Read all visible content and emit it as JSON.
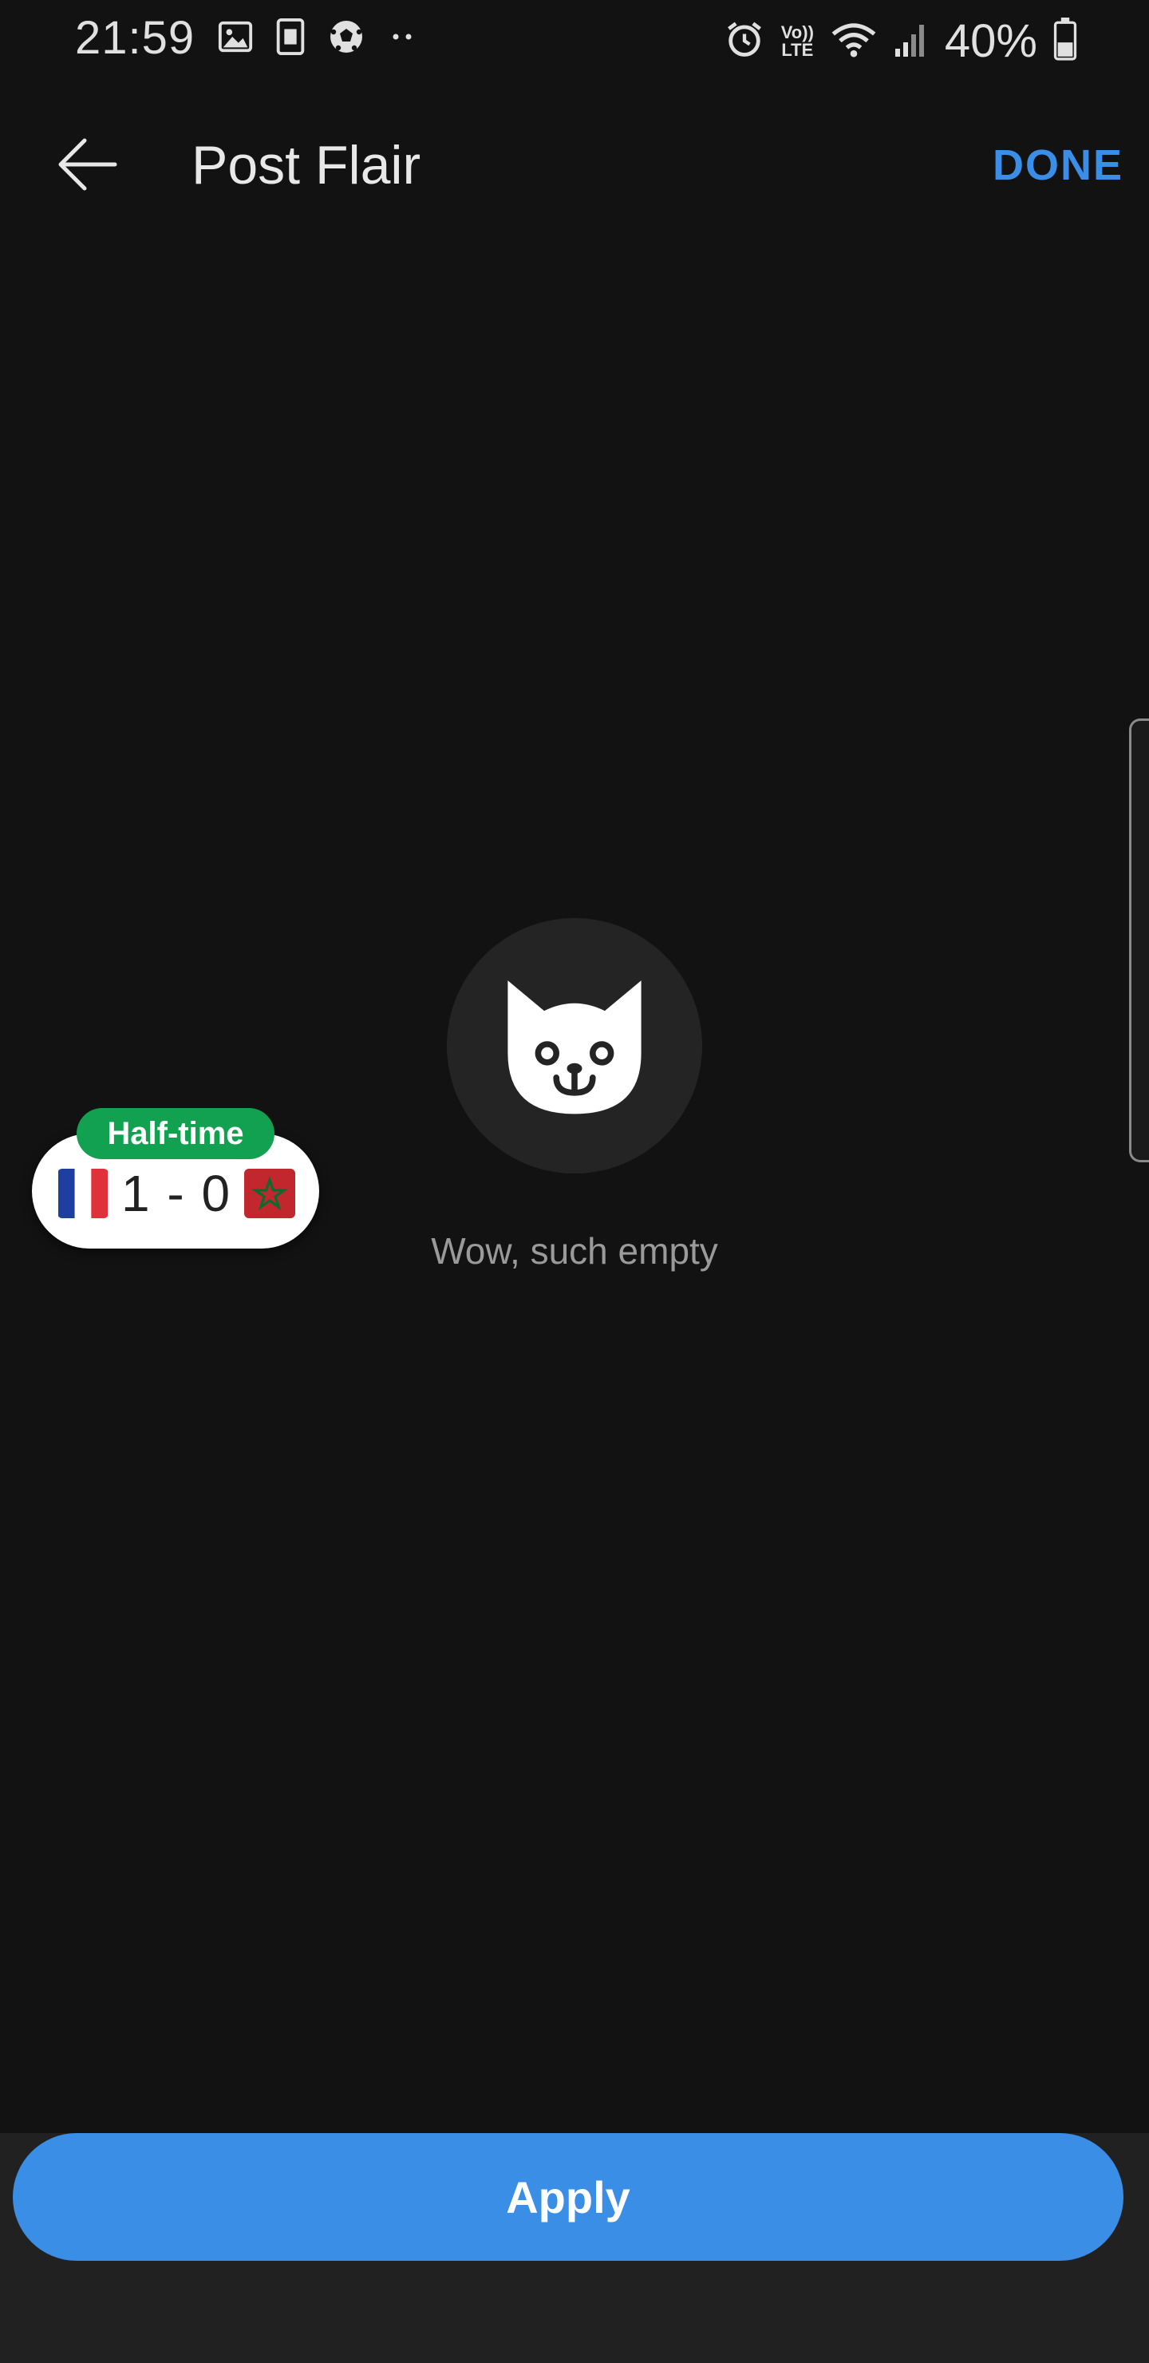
{
  "status_bar": {
    "time": "21:59",
    "battery": "40%",
    "left_icons": [
      "image-icon",
      "sim-card-icon",
      "soccer-ball-icon",
      "dots-icon"
    ],
    "right_icons": [
      "alarm-icon",
      "volte-icon",
      "wifi-icon",
      "signal-icon",
      "battery-icon"
    ],
    "volte_label_top": "Vo))",
    "volte_label_bottom": "LTE"
  },
  "header": {
    "title": "Post Flair",
    "done_label": "DONE",
    "accent_color": "#3b8ee8"
  },
  "empty_state": {
    "message": "Wow, such empty",
    "icon": "cat-face-icon"
  },
  "score_bubble": {
    "badge": "Half-time",
    "score": "1 - 0",
    "home_flag": "france-flag-icon",
    "away_flag": "morocco-flag-icon",
    "badge_color": "#12a150"
  },
  "footer": {
    "apply_label": "Apply",
    "button_color": "#3a8ee6"
  }
}
